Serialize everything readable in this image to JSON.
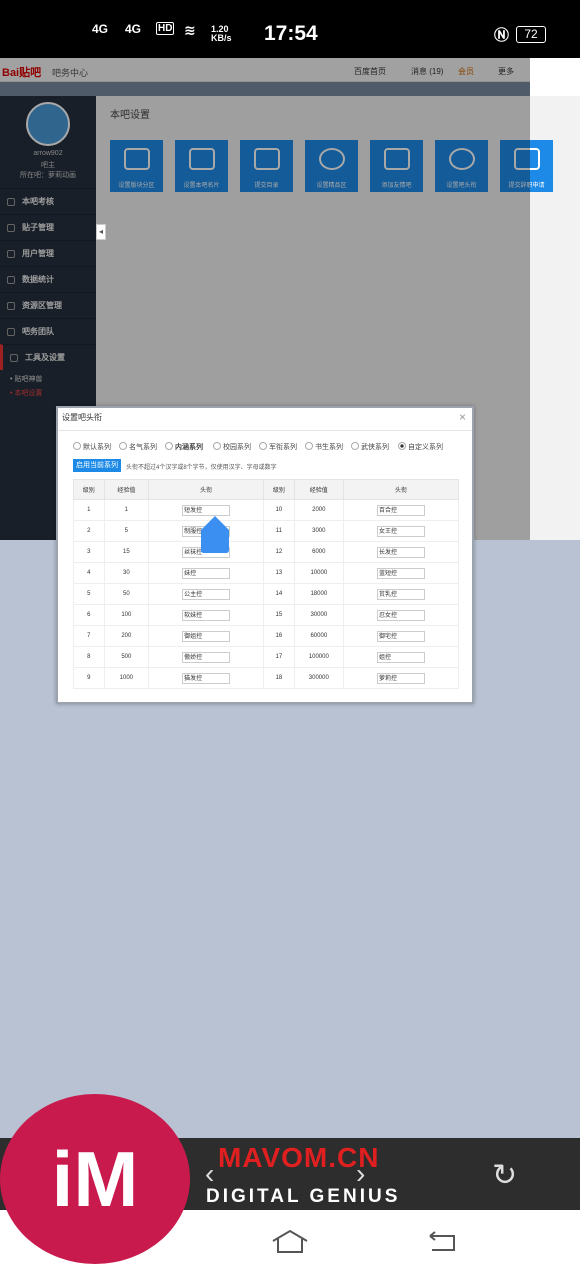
{
  "status": {
    "net1": "4G",
    "net2": "4G",
    "hd": "HD",
    "speed_val": "1.20",
    "speed_unit": "KB/s",
    "time": "17:54",
    "battery": "72"
  },
  "topnav": {
    "logo": "Bai贴吧",
    "subtitle": "吧务中心",
    "items": [
      "百度首页",
      "消息 (19)",
      "会员",
      "更多"
    ]
  },
  "sidebar": {
    "username": "arrow902",
    "role": "吧主",
    "forum": "所在吧：萝莉动画",
    "menu": [
      "本吧考核",
      "贴子管理",
      "用户管理",
      "数据统计",
      "资源区管理",
      "吧务团队",
      "工具及设置"
    ],
    "sub": [
      "贴吧神兽",
      "本吧设置"
    ]
  },
  "main": {
    "heading": "本吧设置",
    "tools": [
      "设置版块分区",
      "设置本吧名片",
      "提交目录",
      "设置精品区",
      "添加友情吧",
      "设置吧头衔",
      "提交辞职申请"
    ]
  },
  "dialog": {
    "title": "设置吧头衔",
    "series": [
      "默认系列",
      "名气系列",
      "内涵系列",
      "校园系列",
      "军衔系列",
      "书生系列",
      "武侠系列",
      "自定义系列"
    ],
    "selected_series": "自定义系列",
    "apply_label": "启用当前系列",
    "hint": "头衔不超过4个汉字或8个字节，仅使用汉字、字母或数字",
    "headers": [
      "级别",
      "经验值",
      "头衔",
      "级别",
      "经验值",
      "头衔"
    ],
    "rows": [
      [
        "1",
        "1",
        "短发控",
        "10",
        "2000",
        "百合控"
      ],
      [
        "2",
        "5",
        "制服控",
        "11",
        "3000",
        "女王控"
      ],
      [
        "3",
        "15",
        "丝袜控",
        "12",
        "6000",
        "长发控"
      ],
      [
        "4",
        "30",
        "妹控",
        "13",
        "10000",
        "蓝短控"
      ],
      [
        "5",
        "50",
        "公主控",
        "14",
        "18000",
        "贫乳控"
      ],
      [
        "6",
        "100",
        "软妹控",
        "15",
        "30000",
        "忍女控"
      ],
      [
        "7",
        "200",
        "御姐控",
        "16",
        "60000",
        "御宅控"
      ],
      [
        "8",
        "500",
        "傲娇控",
        "17",
        "100000",
        "姐控"
      ],
      [
        "9",
        "1000",
        "猫发控",
        "18",
        "300000",
        "萝莉控"
      ]
    ]
  },
  "watermark": {
    "brand": "MAVOM.CN",
    "tagline": "DIGITAL GENIUS",
    "logo": "iM"
  },
  "colors": {
    "accent": "#1d8ae8",
    "sidebar": "#25303d",
    "backdrop": "#b8c2d2"
  }
}
